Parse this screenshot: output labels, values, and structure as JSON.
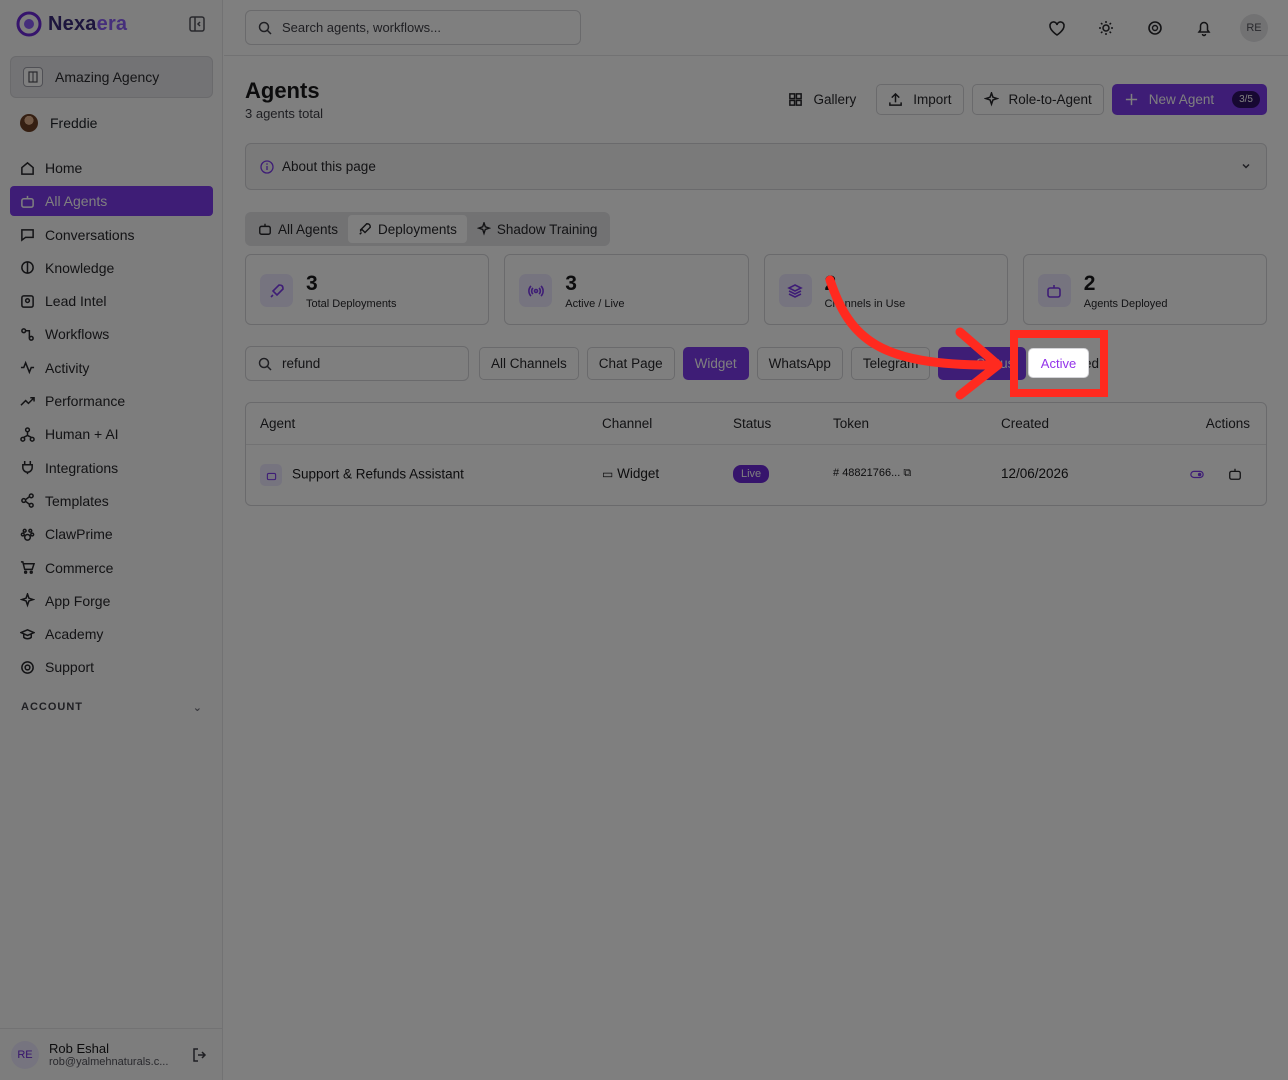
{
  "brand": {
    "name_part1": "Nexa",
    "name_part2": "era"
  },
  "sidebar": {
    "agency": "Amazing Agency",
    "user": "Freddie",
    "items": [
      {
        "label": "Home",
        "icon": "home-icon"
      },
      {
        "label": "All Agents",
        "icon": "bot-icon",
        "active": true
      },
      {
        "label": "Conversations",
        "icon": "chat-icon"
      },
      {
        "label": "Knowledge",
        "icon": "brain-icon"
      },
      {
        "label": "Lead Intel",
        "icon": "contact-icon"
      },
      {
        "label": "Workflows",
        "icon": "workflow-icon"
      },
      {
        "label": "Activity",
        "icon": "activity-icon"
      },
      {
        "label": "Performance",
        "icon": "trend-icon"
      },
      {
        "label": "Human + AI",
        "icon": "network-icon"
      },
      {
        "label": "Integrations",
        "icon": "plug-icon"
      },
      {
        "label": "Templates",
        "icon": "share-icon"
      },
      {
        "label": "ClawPrime",
        "icon": "paw-icon"
      },
      {
        "label": "Commerce",
        "icon": "cart-icon"
      },
      {
        "label": "App Forge",
        "icon": "sparkles-icon"
      },
      {
        "label": "Academy",
        "icon": "graduation-icon"
      },
      {
        "label": "Support",
        "icon": "lifebuoy-icon"
      }
    ],
    "account_label": "ACCOUNT",
    "footer": {
      "initials": "RE",
      "name": "Rob Eshal",
      "email": "rob@yalmehnaturals.c..."
    }
  },
  "topbar": {
    "search_placeholder": "Search agents, workflows...",
    "avatar_initials": "RE"
  },
  "page": {
    "title": "Agents",
    "subtitle": "3 agents total",
    "actions": {
      "gallery": "Gallery",
      "import": "Import",
      "role_to_agent": "Role-to-Agent",
      "new_agent": "New Agent",
      "new_agent_count": "3/5"
    },
    "about": "About this page",
    "tabs": [
      "All Agents",
      "Deployments",
      "Shadow Training"
    ],
    "stats": [
      {
        "value": "3",
        "label": "Total Deployments"
      },
      {
        "value": "3",
        "label": "Active / Live"
      },
      {
        "value": "2",
        "label": "Channels in Use"
      },
      {
        "value": "2",
        "label": "Agents Deployed"
      }
    ],
    "filter_search": "refund",
    "channel_filters": [
      "All Channels",
      "Chat Page",
      "Widget",
      "WhatsApp",
      "Telegram"
    ],
    "status_chip": "Status",
    "status_option_active": "Active",
    "status_option_disabled": "Disabled"
  },
  "table": {
    "headers": [
      "Agent",
      "Channel",
      "Status",
      "Token",
      "Created",
      "Actions"
    ],
    "rows": [
      {
        "agent": "Support & Refunds Assistant",
        "channel": "Widget",
        "status": "Live",
        "token": "48821766...",
        "created": "12/06/2026"
      }
    ]
  },
  "colors": {
    "accent": "#7c3aed",
    "annotation": "#ff2a1f"
  }
}
